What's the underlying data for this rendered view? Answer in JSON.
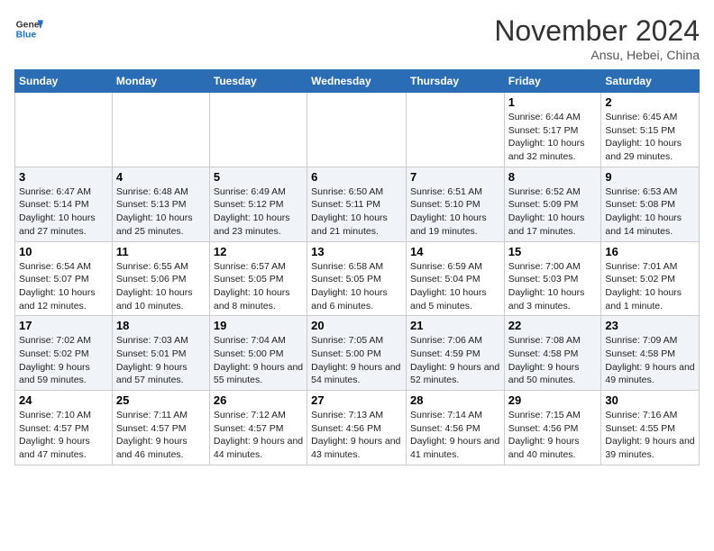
{
  "header": {
    "logo_line1": "General",
    "logo_line2": "Blue",
    "month": "November 2024",
    "location": "Ansu, Hebei, China"
  },
  "days_of_week": [
    "Sunday",
    "Monday",
    "Tuesday",
    "Wednesday",
    "Thursday",
    "Friday",
    "Saturday"
  ],
  "weeks": [
    [
      {
        "day": "",
        "info": ""
      },
      {
        "day": "",
        "info": ""
      },
      {
        "day": "",
        "info": ""
      },
      {
        "day": "",
        "info": ""
      },
      {
        "day": "",
        "info": ""
      },
      {
        "day": "1",
        "info": "Sunrise: 6:44 AM\nSunset: 5:17 PM\nDaylight: 10 hours and 32 minutes."
      },
      {
        "day": "2",
        "info": "Sunrise: 6:45 AM\nSunset: 5:15 PM\nDaylight: 10 hours and 29 minutes."
      }
    ],
    [
      {
        "day": "3",
        "info": "Sunrise: 6:47 AM\nSunset: 5:14 PM\nDaylight: 10 hours and 27 minutes."
      },
      {
        "day": "4",
        "info": "Sunrise: 6:48 AM\nSunset: 5:13 PM\nDaylight: 10 hours and 25 minutes."
      },
      {
        "day": "5",
        "info": "Sunrise: 6:49 AM\nSunset: 5:12 PM\nDaylight: 10 hours and 23 minutes."
      },
      {
        "day": "6",
        "info": "Sunrise: 6:50 AM\nSunset: 5:11 PM\nDaylight: 10 hours and 21 minutes."
      },
      {
        "day": "7",
        "info": "Sunrise: 6:51 AM\nSunset: 5:10 PM\nDaylight: 10 hours and 19 minutes."
      },
      {
        "day": "8",
        "info": "Sunrise: 6:52 AM\nSunset: 5:09 PM\nDaylight: 10 hours and 17 minutes."
      },
      {
        "day": "9",
        "info": "Sunrise: 6:53 AM\nSunset: 5:08 PM\nDaylight: 10 hours and 14 minutes."
      }
    ],
    [
      {
        "day": "10",
        "info": "Sunrise: 6:54 AM\nSunset: 5:07 PM\nDaylight: 10 hours and 12 minutes."
      },
      {
        "day": "11",
        "info": "Sunrise: 6:55 AM\nSunset: 5:06 PM\nDaylight: 10 hours and 10 minutes."
      },
      {
        "day": "12",
        "info": "Sunrise: 6:57 AM\nSunset: 5:05 PM\nDaylight: 10 hours and 8 minutes."
      },
      {
        "day": "13",
        "info": "Sunrise: 6:58 AM\nSunset: 5:05 PM\nDaylight: 10 hours and 6 minutes."
      },
      {
        "day": "14",
        "info": "Sunrise: 6:59 AM\nSunset: 5:04 PM\nDaylight: 10 hours and 5 minutes."
      },
      {
        "day": "15",
        "info": "Sunrise: 7:00 AM\nSunset: 5:03 PM\nDaylight: 10 hours and 3 minutes."
      },
      {
        "day": "16",
        "info": "Sunrise: 7:01 AM\nSunset: 5:02 PM\nDaylight: 10 hours and 1 minute."
      }
    ],
    [
      {
        "day": "17",
        "info": "Sunrise: 7:02 AM\nSunset: 5:02 PM\nDaylight: 9 hours and 59 minutes."
      },
      {
        "day": "18",
        "info": "Sunrise: 7:03 AM\nSunset: 5:01 PM\nDaylight: 9 hours and 57 minutes."
      },
      {
        "day": "19",
        "info": "Sunrise: 7:04 AM\nSunset: 5:00 PM\nDaylight: 9 hours and 55 minutes."
      },
      {
        "day": "20",
        "info": "Sunrise: 7:05 AM\nSunset: 5:00 PM\nDaylight: 9 hours and 54 minutes."
      },
      {
        "day": "21",
        "info": "Sunrise: 7:06 AM\nSunset: 4:59 PM\nDaylight: 9 hours and 52 minutes."
      },
      {
        "day": "22",
        "info": "Sunrise: 7:08 AM\nSunset: 4:58 PM\nDaylight: 9 hours and 50 minutes."
      },
      {
        "day": "23",
        "info": "Sunrise: 7:09 AM\nSunset: 4:58 PM\nDaylight: 9 hours and 49 minutes."
      }
    ],
    [
      {
        "day": "24",
        "info": "Sunrise: 7:10 AM\nSunset: 4:57 PM\nDaylight: 9 hours and 47 minutes."
      },
      {
        "day": "25",
        "info": "Sunrise: 7:11 AM\nSunset: 4:57 PM\nDaylight: 9 hours and 46 minutes."
      },
      {
        "day": "26",
        "info": "Sunrise: 7:12 AM\nSunset: 4:57 PM\nDaylight: 9 hours and 44 minutes."
      },
      {
        "day": "27",
        "info": "Sunrise: 7:13 AM\nSunset: 4:56 PM\nDaylight: 9 hours and 43 minutes."
      },
      {
        "day": "28",
        "info": "Sunrise: 7:14 AM\nSunset: 4:56 PM\nDaylight: 9 hours and 41 minutes."
      },
      {
        "day": "29",
        "info": "Sunrise: 7:15 AM\nSunset: 4:56 PM\nDaylight: 9 hours and 40 minutes."
      },
      {
        "day": "30",
        "info": "Sunrise: 7:16 AM\nSunset: 4:55 PM\nDaylight: 9 hours and 39 minutes."
      }
    ]
  ]
}
